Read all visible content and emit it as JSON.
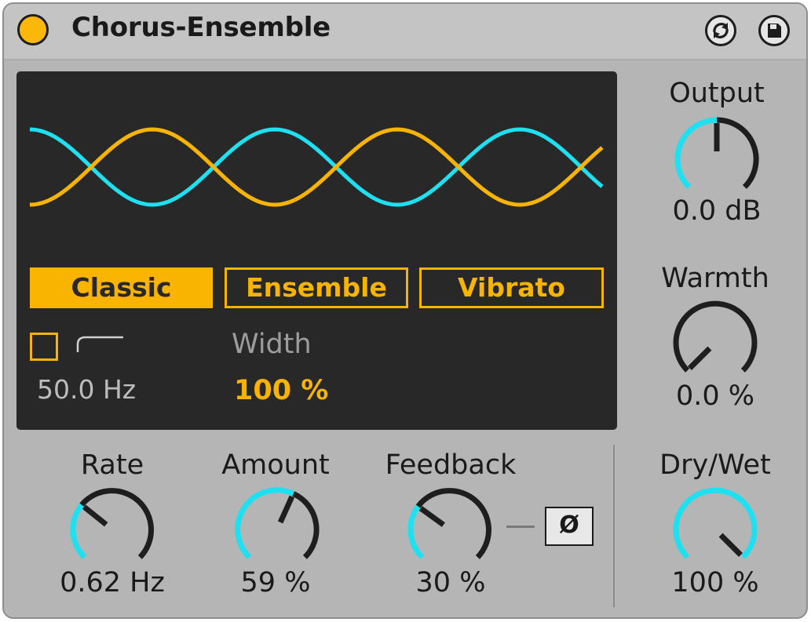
{
  "device": {
    "title": "Chorus-Ensemble",
    "power_on": true,
    "accent_color": "#f8b400",
    "cyan_color": "#1ee0f0"
  },
  "title_buttons": [
    {
      "name": "refresh-icon"
    },
    {
      "name": "save-icon"
    }
  ],
  "display": {
    "modes": [
      {
        "label": "Classic",
        "active": true
      },
      {
        "label": "Ensemble",
        "active": false
      },
      {
        "label": "Vibrato",
        "active": false
      }
    ],
    "highpass": {
      "enabled": false,
      "icon": "highpass-icon",
      "value": "50.0 Hz"
    },
    "width": {
      "label": "Width",
      "value": "100 %"
    }
  },
  "knobs": {
    "output": {
      "label": "Output",
      "value": "0.0 dB",
      "position": 0.5
    },
    "warmth": {
      "label": "Warmth",
      "value": "0.0 %",
      "position": 0.0
    },
    "rate": {
      "label": "Rate",
      "value": "0.62 Hz",
      "position": 0.31
    },
    "amount": {
      "label": "Amount",
      "value": "59 %",
      "position": 0.59
    },
    "feedback": {
      "label": "Feedback",
      "value": "30 %",
      "position": 0.3
    },
    "drywet": {
      "label": "Dry/Wet",
      "value": "100 %",
      "position": 1.0
    }
  },
  "feedback_invert": {
    "label": "Ø"
  }
}
